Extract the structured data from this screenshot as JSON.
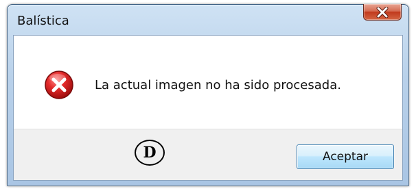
{
  "window": {
    "title": "Balística",
    "close_icon": "close-x-icon"
  },
  "dialog": {
    "icon": "error-icon",
    "message": "La actual imagen no ha sido procesada."
  },
  "annotation": {
    "marker_label": "D"
  },
  "buttons": {
    "accept_label": "Aceptar"
  },
  "colors": {
    "close_button": "#c74a2c",
    "error_red": "#d01e1e",
    "button_border": "#3c7fb1",
    "title_bar": "#b9d1ea"
  }
}
